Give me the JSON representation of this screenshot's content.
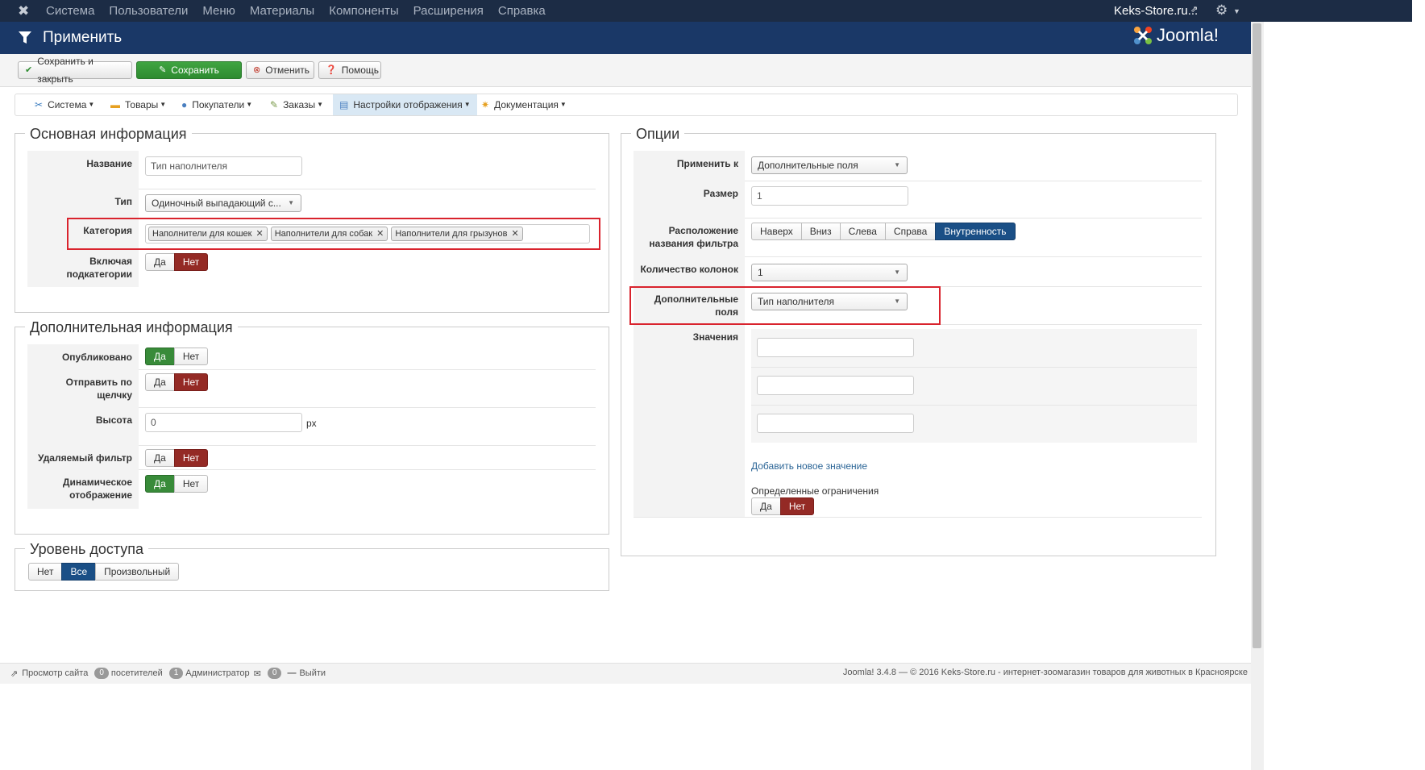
{
  "topnav": {
    "menu": [
      "Система",
      "Пользователи",
      "Меню",
      "Материалы",
      "Компоненты",
      "Расширения",
      "Справка"
    ],
    "site": "Keks-Store.ru..."
  },
  "header": {
    "title": "Применить",
    "logo": "Joomla!"
  },
  "toolbar": {
    "save_close": "Сохранить и закрыть",
    "save": "Сохранить",
    "cancel": "Отменить",
    "help": "Помощь"
  },
  "tabs": [
    "Система",
    "Товары",
    "Покупатели",
    "Заказы",
    "Настройки отображения",
    "Документация"
  ],
  "basic": {
    "legend": "Основная информация",
    "name_label": "Название",
    "name_value": "Тип наполнителя",
    "type_label": "Тип",
    "type_value": "Одиночный выпадающий с...",
    "category_label": "Категория",
    "categories": [
      "Наполнители для кошек",
      "Наполнители для собак",
      "Наполнители для грызунов"
    ],
    "subcat_label": "Включая подкатегории",
    "yes": "Да",
    "no": "Нет"
  },
  "extra": {
    "legend": "Дополнительная информация",
    "published_label": "Опубликовано",
    "send_label": "Отправить по щелчку",
    "height_label": "Высота",
    "height_value": "0",
    "height_unit": "px",
    "removable_label": "Удаляемый фильтр",
    "dynamic_label": "Динамическое отображение",
    "yes": "Да",
    "no": "Нет"
  },
  "access": {
    "legend": "Уровень доступа",
    "options": [
      "Нет",
      "Все",
      "Произвольный"
    ]
  },
  "options": {
    "legend": "Опции",
    "apply_to_label": "Применить к",
    "apply_to_value": "Дополнительные поля",
    "size_label": "Размер",
    "size_value": "1",
    "position_label": "Расположение названия фильтра",
    "positions": [
      "Наверх",
      "Вниз",
      "Слева",
      "Справа",
      "Внутренность"
    ],
    "columns_label": "Количество колонок",
    "columns_value": "1",
    "fields_label": "Дополнительные поля",
    "fields_value": "Тип наполнителя",
    "values_label": "Значения",
    "add_value": "Добавить новое значение",
    "limits_label": "Определенные ограничения",
    "yes": "Да",
    "no": "Нет"
  },
  "footer": {
    "view_site": "Просмотр сайта",
    "visitors_count": "0",
    "visitors": "посетителей",
    "admin_count": "1",
    "admin": "Администратор",
    "msg_count": "0",
    "logout": "Выйти",
    "copyright": "Joomla! 3.4.8 — © 2016 Keks-Store.ru - интернет-зоомагазин товаров для животных в Красноярске"
  }
}
